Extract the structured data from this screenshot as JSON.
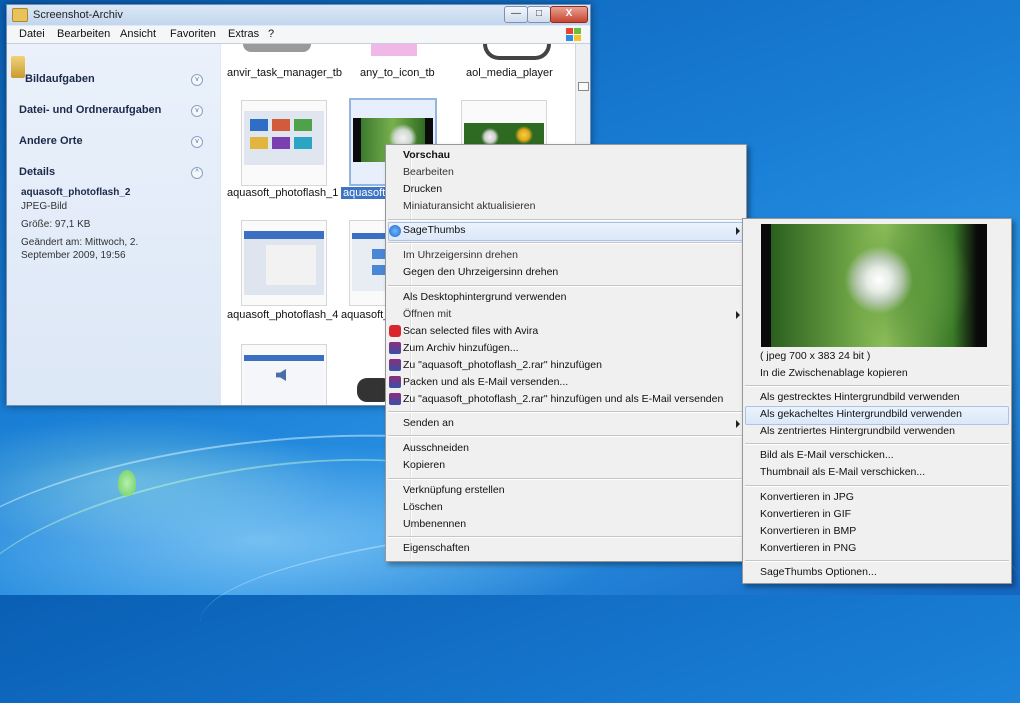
{
  "window": {
    "title": "Screenshot-Archiv",
    "buttons": {
      "minimize": "—",
      "maximize": "□",
      "close": "X"
    }
  },
  "menubar": [
    "Datei",
    "Bearbeiten",
    "Ansicht",
    "Favoriten",
    "Extras",
    "?"
  ],
  "sidebar": {
    "sections": [
      "Bildaufgaben",
      "Datei- und Ordneraufgaben",
      "Andere Orte",
      "Details"
    ],
    "details": {
      "filename": "aquasoft_photoflash_2",
      "type": "JPEG-Bild",
      "size": "Größe: 97,1 KB",
      "modified_line1": "Geändert am: Mittwoch, 2.",
      "modified_line2": "September 2009, 19:56"
    }
  },
  "files": [
    "anvir_task_manager_tb",
    "any_to_icon_tb",
    "aol_media_player",
    "aquasoft_photoflash_1",
    "aquasoft_p",
    "aquasoft_photoflash_4",
    "aquasoft_p"
  ],
  "context_menu": {
    "items": [
      "Vorschau",
      "Bearbeiten",
      "Drucken",
      "Miniaturansicht aktualisieren",
      "SageThumbs",
      "Im Uhrzeigersinn drehen",
      "Gegen den Uhrzeigersinn drehen",
      "Als Desktophintergrund verwenden",
      "Öffnen mit",
      "Scan selected files with Avira",
      "Zum Archiv hinzufügen...",
      "Zu \"aquasoft_photoflash_2.rar\" hinzufügen",
      "Packen und als E-Mail versenden...",
      "Zu \"aquasoft_photoflash_2.rar\" hinzufügen und als E-Mail versenden",
      "Senden an",
      "Ausschneiden",
      "Kopieren",
      "Verknüpfung erstellen",
      "Löschen",
      "Umbenennen",
      "Eigenschaften"
    ]
  },
  "submenu": {
    "image_info": "( jpeg 700 x 383 24 bit )",
    "items": [
      "In die Zwischenablage kopieren",
      "Als gestrecktes Hintergrundbild verwenden",
      "Als gekacheltes Hintergrundbild verwenden",
      "Als zentriertes Hintergrundbild verwenden",
      "Bild als E-Mail verschicken...",
      "Thumbnail als E-Mail verschicken...",
      "Konvertieren in JPG",
      "Konvertieren in GIF",
      "Konvertieren in BMP",
      "Konvertieren in PNG",
      "SageThumbs Optionen..."
    ]
  },
  "colors": {
    "selection": "#3d74c4",
    "desktop": "#1a7fd6",
    "menu_bg": "#f0f0f0"
  }
}
